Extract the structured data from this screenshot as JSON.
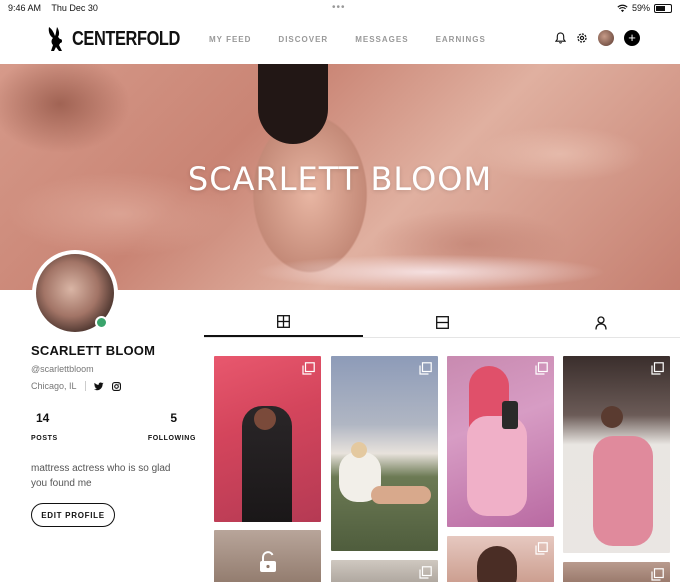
{
  "status": {
    "time": "9:46 AM",
    "date": "Thu Dec 30",
    "battery": "59%"
  },
  "brand": {
    "name": "CENTERFOLD"
  },
  "nav": {
    "links": [
      "MY FEED",
      "DISCOVER",
      "MESSAGES",
      "EARNINGS"
    ]
  },
  "banner": {
    "title": "SCARLETT BLOOM"
  },
  "profile": {
    "name": "SCARLETT BLOOM",
    "handle": "@scarlettbloom",
    "location": "Chicago, IL",
    "bio": "mattress actress who is so glad you found me",
    "edit_label": "EDIT PROFILE",
    "online": true
  },
  "stats": {
    "posts": {
      "count": "14",
      "label": "POSTS"
    },
    "following": {
      "count": "5",
      "label": "FOLLOWING"
    }
  },
  "tabs": [
    {
      "icon": "grid-icon",
      "active": true
    },
    {
      "icon": "feed-icon",
      "active": false
    },
    {
      "icon": "person-icon",
      "active": false
    }
  ],
  "colors": {
    "online": "#3aa46c",
    "banner": "#c98474"
  }
}
